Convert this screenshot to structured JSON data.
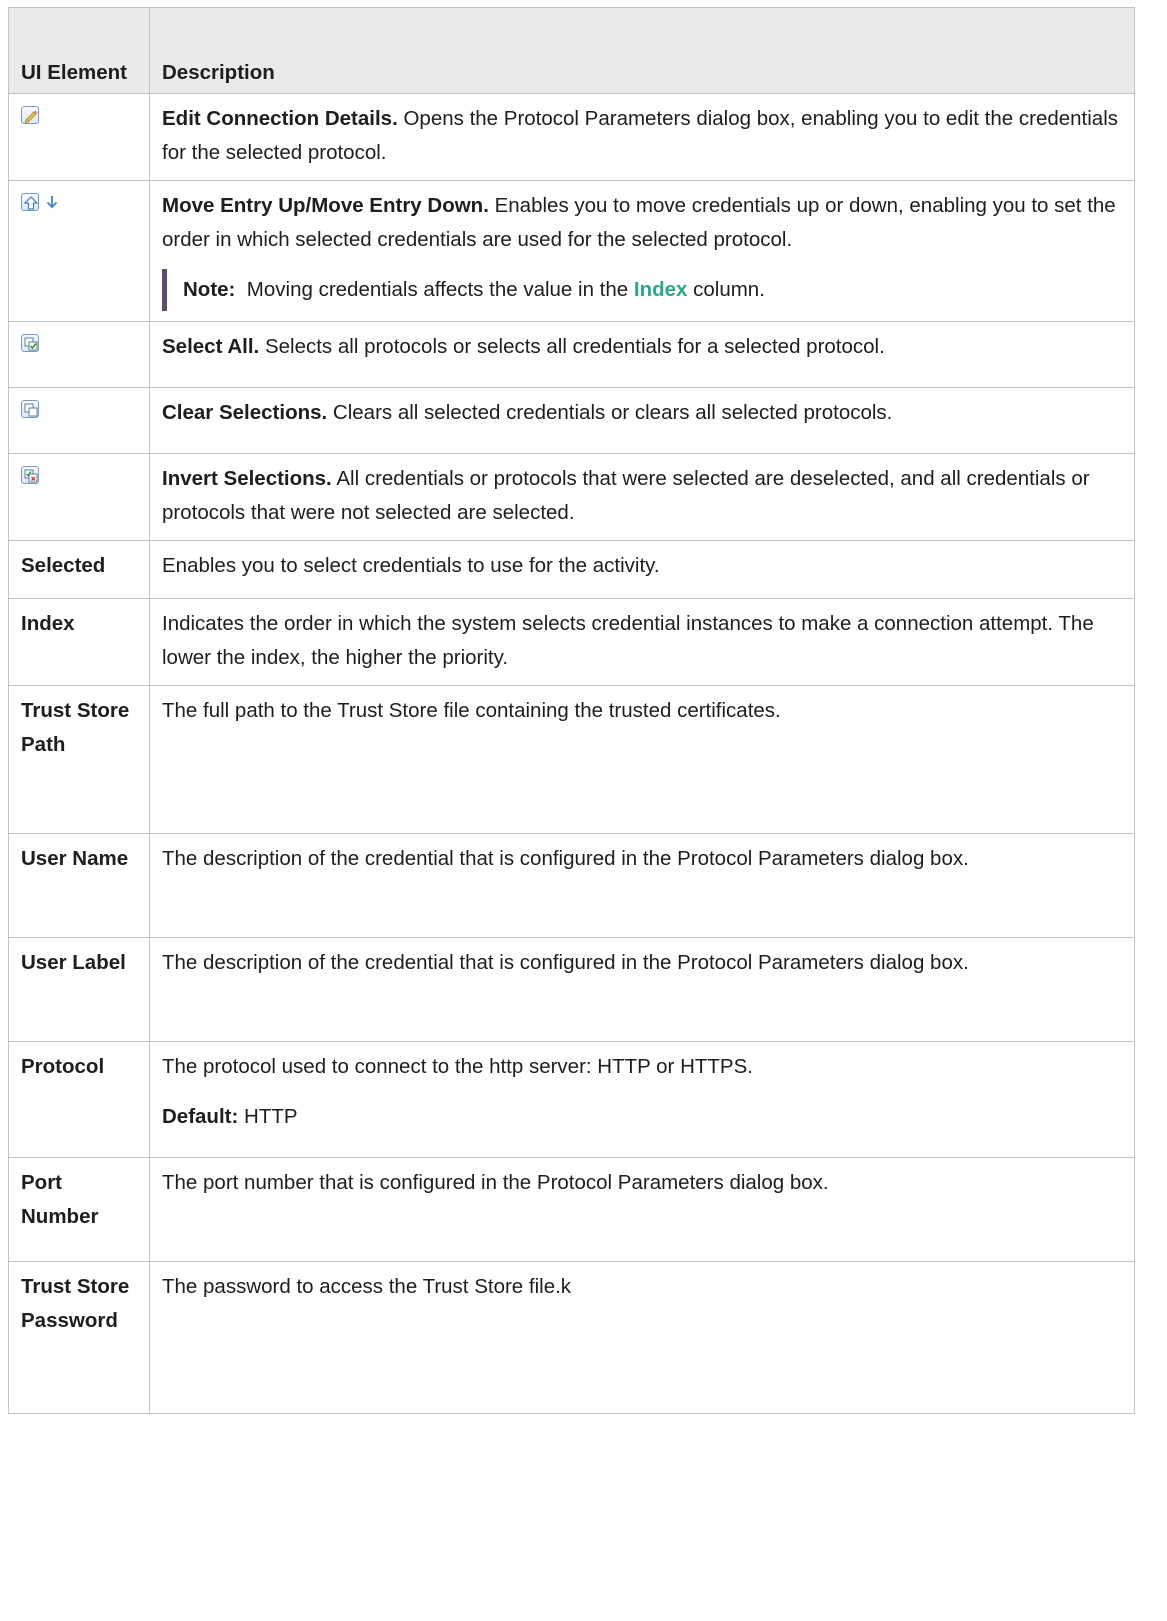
{
  "header": {
    "col1": "UI Element",
    "col2": "Description"
  },
  "rows": [
    {
      "icon": "pencil-edit-icon",
      "title": "Edit Connection Details.",
      "text": "Opens the Protocol Parameters dialog box, enabling you to edit the credentials for the selected protocol."
    },
    {
      "icon": "move-up-down-icons",
      "title": "Move Entry Up/Move Entry Down.",
      "text": "Enables you to move credentials up or down, enabling you to set the order in which selected credentials are used for the selected protocol.",
      "note": {
        "label": "Note:",
        "before": "Moving credentials affects the value in the",
        "link": "Index",
        "after": "column."
      }
    },
    {
      "icon": "select-all-icon",
      "title": "Select All.",
      "text": "Selects all protocols or selects all credentials for a selected protocol."
    },
    {
      "icon": "clear-selections-icon",
      "title": "Clear Selections.",
      "text": "Clears all selected credentials or clears all selected protocols."
    },
    {
      "icon": "invert-selections-icon",
      "title": "Invert Selections.",
      "text": "All credentials or protocols that were selected are deselected, and all credentials or protocols that were not selected are selected."
    },
    {
      "element": "Selected",
      "text": "Enables you to select credentials to use for the activity."
    },
    {
      "element": "Index",
      "text": "Indicates the order in which the system selects credential instances to make a connection attempt. The lower the index, the higher the priority."
    },
    {
      "element": "Trust Store Path",
      "text": "The full path to the Trust Store file containing the trusted certificates."
    },
    {
      "element": "User Name",
      "text": "The description of the credential that is configured in the Protocol Parameters dialog box."
    },
    {
      "element": "User Label",
      "text": "The description of the credential that is configured in the Protocol Parameters dialog box."
    },
    {
      "element": "Protocol",
      "text": "The protocol used to connect to the http server: HTTP or HTTPS.",
      "default_label": "Default:",
      "default_value": "HTTP"
    },
    {
      "element": "Port Number",
      "text": "The port number that is configured in the Protocol Parameters dialog box."
    },
    {
      "element": "Trust Store Password",
      "text": "The password to access the Trust Store file.k"
    }
  ]
}
